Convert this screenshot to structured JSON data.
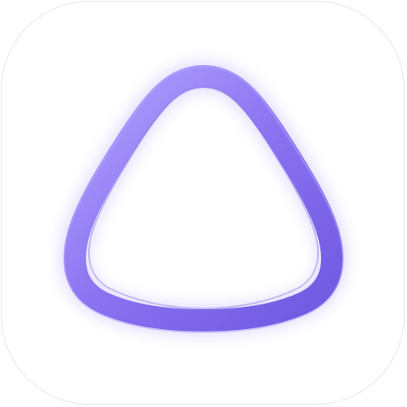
{
  "app_icon": {
    "icon": "alice-ring-icon",
    "tile_color": "#ffffff",
    "tile_border_color": "#e6e6e6",
    "ring_color": "#8a72f0",
    "ring_highlight_color": "#b3a5ff",
    "ring_shadow_color": "#6e58e0",
    "glow_color": "#9d8cff"
  }
}
